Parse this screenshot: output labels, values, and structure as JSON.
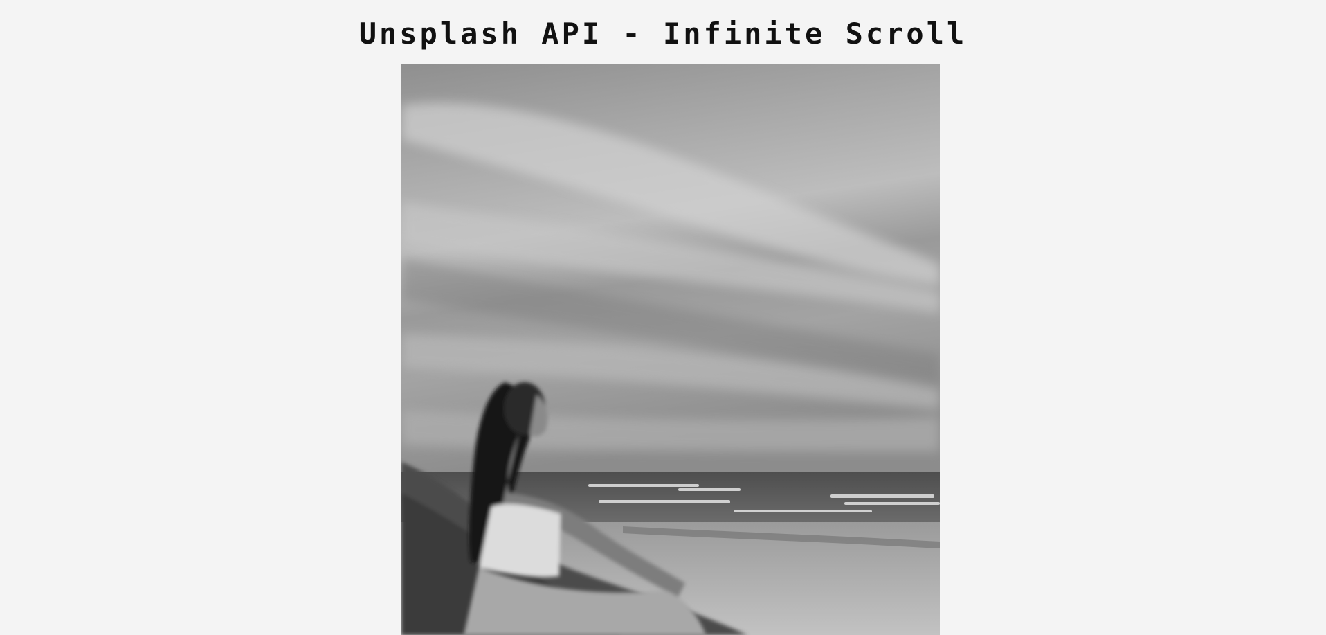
{
  "header": {
    "title": "Unsplash API - Infinite Scroll"
  },
  "gallery": {
    "images": [
      {
        "description": "black and white photo of a woman sitting on beach dunes looking at the sea",
        "icon": "photo-icon"
      }
    ]
  },
  "colors": {
    "background": "#f4f4f4",
    "title": "#111111"
  }
}
